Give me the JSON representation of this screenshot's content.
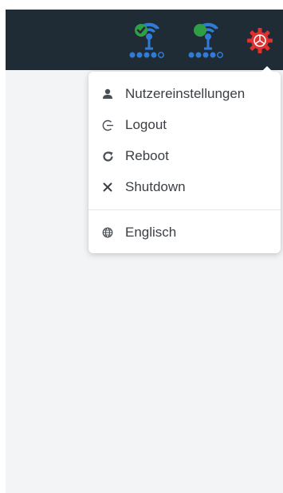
{
  "topbar": {
    "status_indicators": [
      {
        "icon": "antenna-check-icon",
        "badge_color": "#2f9e44",
        "signal_dots": 4
      },
      {
        "icon": "antenna-icon",
        "badge_color": "#2f9e44",
        "signal_dots": 4
      }
    ],
    "settings_icon": "gear-icon",
    "settings_color": "#e03131",
    "background": "#1f2b35"
  },
  "user_menu": {
    "items": [
      {
        "label": "Nutzereinstellungen",
        "icon": "user-icon"
      },
      {
        "label": "Logout",
        "icon": "logout-icon"
      },
      {
        "label": "Reboot",
        "icon": "reboot-icon"
      },
      {
        "label": "Shutdown",
        "icon": "close-icon"
      }
    ],
    "language": {
      "label": "Englisch",
      "icon": "globe-icon"
    }
  }
}
